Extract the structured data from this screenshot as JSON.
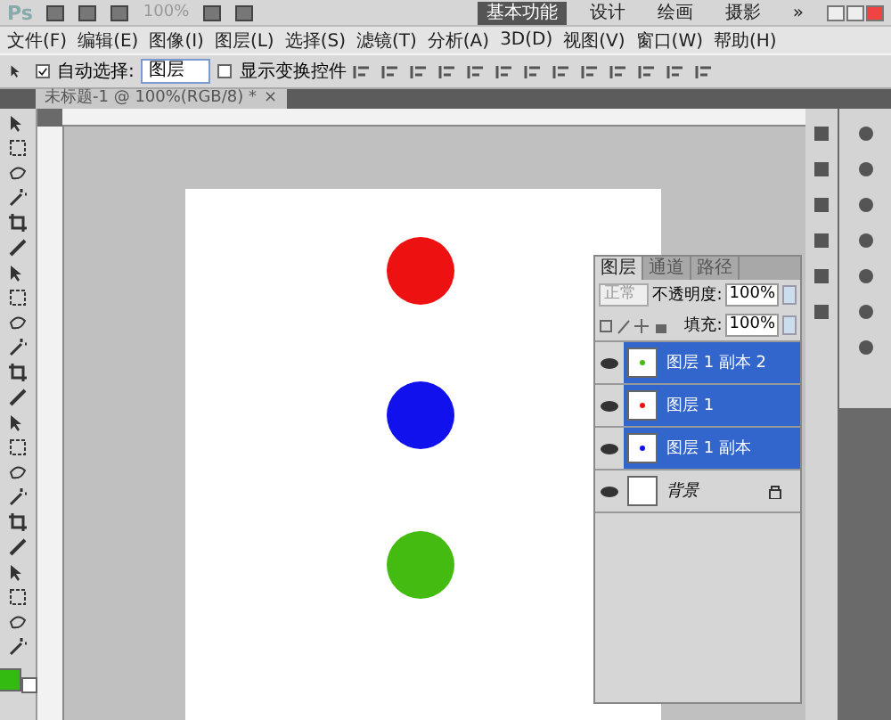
{
  "app_bar": {
    "logo": "Ps",
    "zoom": "100%",
    "workspaces": [
      {
        "label": "基本功能",
        "selected": true
      },
      {
        "label": "设计",
        "selected": false
      },
      {
        "label": "绘画",
        "selected": false
      },
      {
        "label": "摄影",
        "selected": false
      }
    ],
    "more": "»"
  },
  "menu": [
    "文件(F)",
    "编辑(E)",
    "图像(I)",
    "图层(L)",
    "选择(S)",
    "滤镜(T)",
    "分析(A)",
    "3D(D)",
    "视图(V)",
    "窗口(W)",
    "帮助(H)"
  ],
  "options": {
    "auto_select": {
      "label": "自动选择:",
      "checked": true
    },
    "target": "图层",
    "show_transform": {
      "label": "显示变换控件",
      "checked": false
    }
  },
  "document_tab": {
    "title": "未标题-1 @ 100%(RGB/8) *",
    "close": "×"
  },
  "toolbox": {
    "swatches": [
      {
        "kind": "foreground",
        "color": "#33bb11"
      },
      {
        "kind": "background",
        "color": "#ffffff"
      }
    ]
  },
  "canvas": {
    "shapes": [
      {
        "kind": "circle",
        "color": "#ee1111"
      },
      {
        "kind": "circle",
        "color": "#1111ee"
      },
      {
        "kind": "circle",
        "color": "#44bb11"
      }
    ]
  },
  "layers_panel": {
    "tabs": [
      {
        "label": "图层",
        "selected": true
      },
      {
        "label": "通道",
        "selected": false
      },
      {
        "label": "路径",
        "selected": false
      }
    ],
    "blend_mode": "正常",
    "opacity_label": "不透明度:",
    "opacity": "100%",
    "fill_label": "填充:",
    "fill": "100%",
    "layers": [
      {
        "name": "图层 1 副本 2",
        "selected": true,
        "locked": false,
        "color": "#44bb11"
      },
      {
        "name": "图层 1",
        "selected": true,
        "locked": false,
        "color": "#ee1111"
      },
      {
        "name": "图层 1 副本",
        "selected": true,
        "locked": false,
        "color": "#1111ee"
      },
      {
        "name": "背景",
        "selected": false,
        "locked": true
      }
    ]
  }
}
